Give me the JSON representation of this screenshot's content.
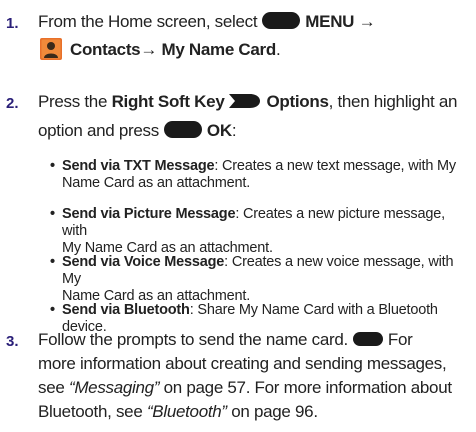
{
  "steps": [
    {
      "number": "1.",
      "line1_pre": "From the Home screen, select",
      "line1_bold": "MENU →",
      "line2_bold": "Contacts→ My Name Card",
      "line2_post": "."
    },
    {
      "number": "2.",
      "line1_pre": "Press the",
      "line1_bold1": "Right Soft Key",
      "line1_bold2": "Options",
      "line1_post": ", then highlight an",
      "line2_pre": "option and press",
      "line2_bold": "OK",
      "line2_post": ":"
    },
    {
      "number": "3.",
      "line1": "Follow the prompts to send the name card.",
      "line1_post": "For",
      "line2": "more information about creating and sending messages,",
      "line3_pre": "see",
      "line3_ref": "“Messaging”",
      "line3_post": "on page 57. For more information about",
      "line4_pre": "Bluetooth, see",
      "line4_ref": "“Bluetooth”",
      "line4_post": "on page 96."
    }
  ],
  "options": [
    {
      "title": "Send via TXT Message",
      "desc1": ": Creates a new text message, with My",
      "desc2": "Name Card as an attachment."
    },
    {
      "title": "Send via Picture Message",
      "desc1": ": Creates a new picture message, with",
      "desc2": "My Name Card as an attachment."
    },
    {
      "title": "Send via Voice Message",
      "desc1": ": Creates a new voice message, with My",
      "desc2": "Name Card as an attachment."
    },
    {
      "title": "Send via Bluetooth",
      "desc1": ": Share My Name Card with a Bluetooth device.",
      "desc2": ""
    }
  ],
  "colors": {
    "step_number": "#2a1f78",
    "text": "#222222",
    "key": "#1a1a1a",
    "contacts_icon": "#e8702a"
  },
  "icons": [
    "menu-key-icon",
    "contacts-icon",
    "right-soft-key-icon",
    "ok-key-icon",
    "clear-key-icon"
  ]
}
